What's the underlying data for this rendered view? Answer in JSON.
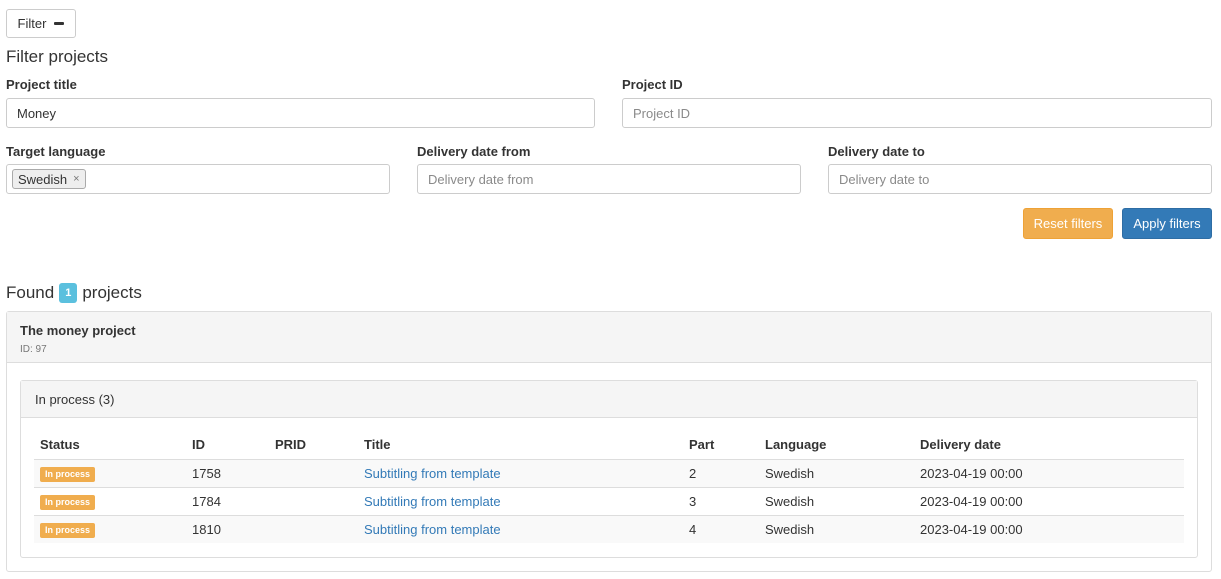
{
  "toolbar": {
    "filter_toggle_label": "Filter"
  },
  "filter": {
    "heading": "Filter projects",
    "project_title": {
      "label": "Project title",
      "value": "Money",
      "placeholder": ""
    },
    "project_id": {
      "label": "Project ID",
      "value": "",
      "placeholder": "Project ID"
    },
    "target_language": {
      "label": "Target language",
      "tags": [
        "Swedish"
      ],
      "remove_glyph": "×"
    },
    "delivery_from": {
      "label": "Delivery date from",
      "value": "",
      "placeholder": "Delivery date from"
    },
    "delivery_to": {
      "label": "Delivery date to",
      "value": "",
      "placeholder": "Delivery date to"
    },
    "reset_label": "Reset filters",
    "apply_label": "Apply filters"
  },
  "results": {
    "found_prefix": "Found",
    "count": "1",
    "found_suffix": "projects",
    "project": {
      "title": "The money project",
      "id_text": "ID: 97",
      "group_title": "In process (3)",
      "columns": [
        "Status",
        "ID",
        "PRID",
        "Title",
        "Part",
        "Language",
        "Delivery date"
      ],
      "rows": [
        {
          "status": "In process",
          "id": "1758",
          "prid": "",
          "title": "Subtitling from template",
          "part": "2",
          "language": "Swedish",
          "delivery": "2023-04-19 00:00"
        },
        {
          "status": "In process",
          "id": "1784",
          "prid": "",
          "title": "Subtitling from template",
          "part": "3",
          "language": "Swedish",
          "delivery": "2023-04-19 00:00"
        },
        {
          "status": "In process",
          "id": "1810",
          "prid": "",
          "title": "Subtitling from template",
          "part": "4",
          "language": "Swedish",
          "delivery": "2023-04-19 00:00"
        }
      ]
    }
  },
  "colors": {
    "primary": "#337ab7",
    "warning": "#f0ad4e",
    "info": "#5bc0de",
    "link": "#337ab7"
  },
  "icons": {
    "filter_toggle": "minus-icon",
    "tag_remove": "close-icon"
  }
}
